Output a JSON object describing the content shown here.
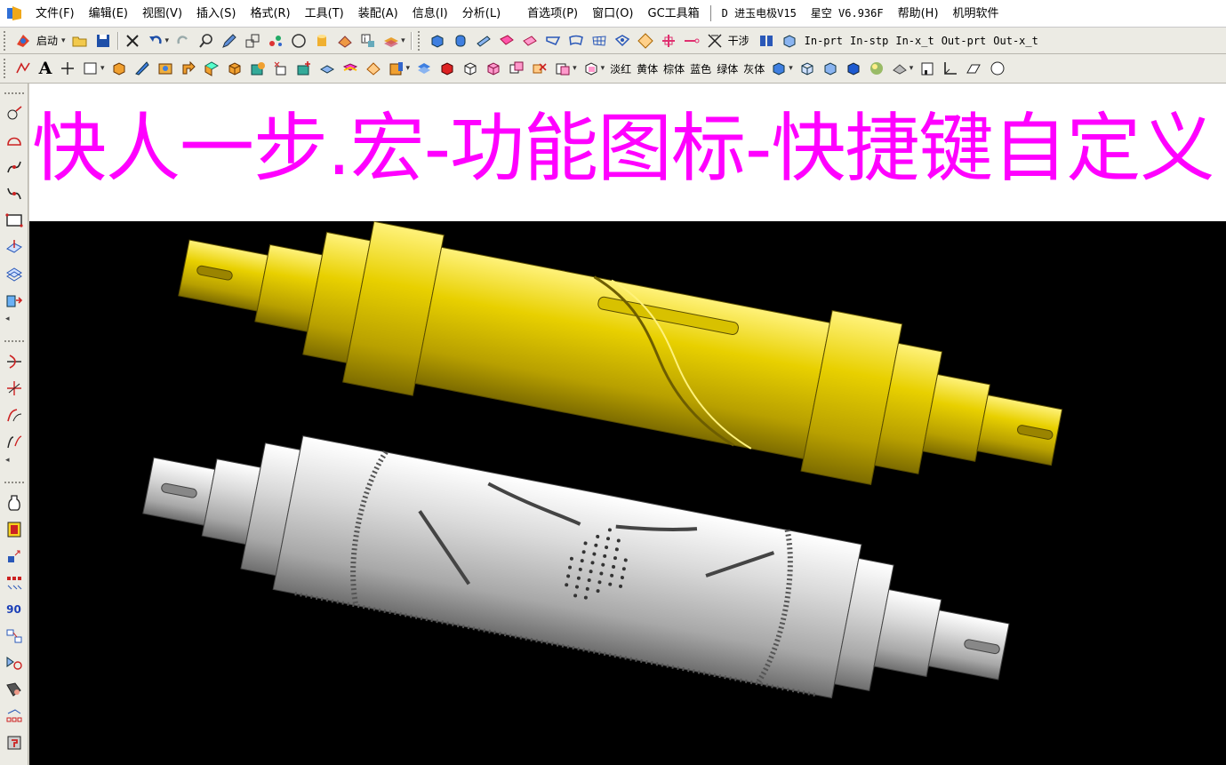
{
  "menubar": {
    "items": [
      "文件(F)",
      "编辑(E)",
      "视图(V)",
      "插入(S)",
      "格式(R)",
      "工具(T)",
      "装配(A)",
      "信息(I)",
      "分析(L)",
      "首选项(P)",
      "窗口(O)",
      "GC工具箱"
    ],
    "plugin_items": [
      "D 进玉电极V15",
      "星空 V6.936F",
      "帮助(H)",
      "机明软件"
    ]
  },
  "toolbar1": {
    "start_label": "启动",
    "gan_she_label": "干涉",
    "texts": [
      "In-prt",
      "In-stp",
      "In-x_t",
      "Out-prt",
      "Out-x_t"
    ]
  },
  "toolbar2": {
    "text_tool": "A",
    "color_labels": [
      "淡红",
      "黄体",
      "棕体",
      "蓝色",
      "绿体",
      "灰体"
    ]
  },
  "left_toolbar": {
    "rotate_label": "90"
  },
  "banner": {
    "title": "快人一步.宏-功能图标-快捷键自定义"
  },
  "colors": {
    "banner_text": "#ff00ff",
    "viewport_bg": "#000000",
    "part_yellow": "#e8d000",
    "part_gray": "#c8c8c8"
  },
  "icons": {
    "left": [
      "point-icon",
      "arc-icon",
      "curve-icon",
      "curve2-icon",
      "rectangle-icon",
      "plane-icon",
      "sheet-icon",
      "extrude-icon",
      "trim-icon",
      "split-icon",
      "bridge-icon",
      "offset-icon",
      "vase-icon",
      "book-icon",
      "axis-icon",
      "array-icon",
      "rotate90-icon",
      "copy-icon",
      "mirror-icon",
      "paint-icon",
      "grid-icon",
      "marker-icon"
    ]
  }
}
